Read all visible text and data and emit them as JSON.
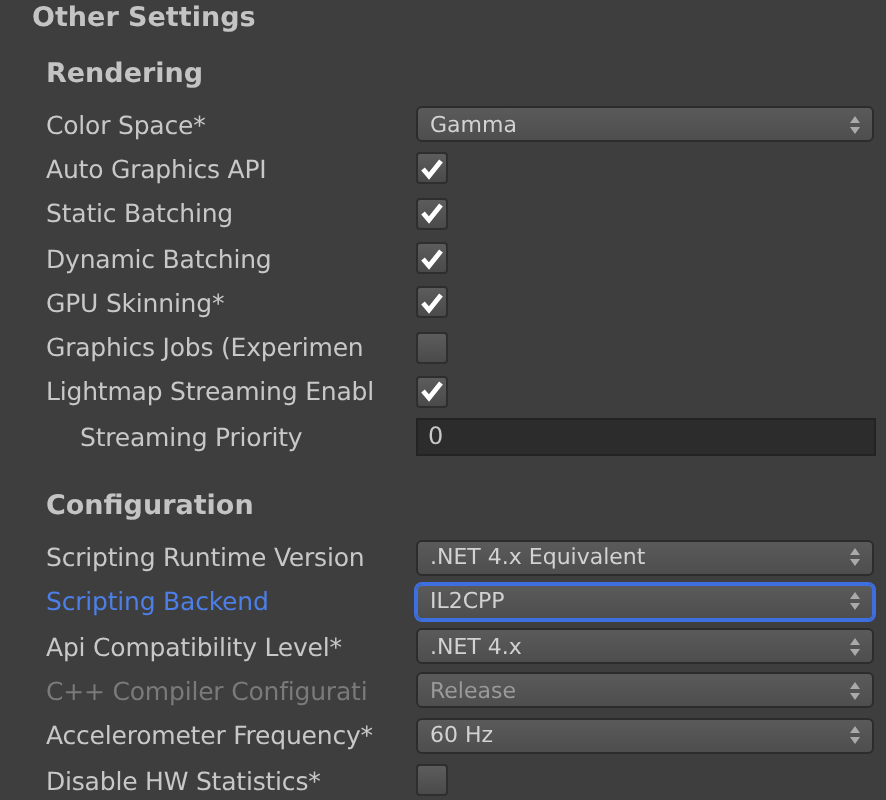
{
  "title": "Other Settings",
  "sections": [
    {
      "heading": "Rendering",
      "rows": [
        {
          "kind": "dropdown",
          "label": "Color Space*",
          "value": "Gamma",
          "focused": false,
          "disabled": false
        },
        {
          "kind": "checkbox",
          "label": "Auto Graphics API",
          "checked": true,
          "disabled": false
        },
        {
          "kind": "checkbox",
          "label": "Static Batching",
          "checked": true,
          "disabled": false
        },
        {
          "kind": "checkbox",
          "label": "Dynamic Batching",
          "checked": true,
          "disabled": false
        },
        {
          "kind": "checkbox",
          "label": "GPU Skinning*",
          "checked": true,
          "disabled": false
        },
        {
          "kind": "checkbox",
          "label": "Graphics Jobs (Experimen",
          "checked": false,
          "disabled": false
        },
        {
          "kind": "checkbox",
          "label": "Lightmap Streaming Enabl",
          "checked": true,
          "disabled": false,
          "children": [
            {
              "kind": "textfield",
              "label": "Streaming Priority",
              "value": "0",
              "disabled": false
            }
          ]
        }
      ]
    },
    {
      "heading": "Configuration",
      "rows": [
        {
          "kind": "dropdown",
          "label": "Scripting Runtime Version",
          "value": ".NET 4.x Equivalent",
          "focused": false,
          "disabled": false
        },
        {
          "kind": "dropdown",
          "label": "Scripting Backend",
          "value": "IL2CPP",
          "focused": true,
          "disabled": false
        },
        {
          "kind": "dropdown",
          "label": "Api Compatibility Level*",
          "value": ".NET 4.x",
          "focused": false,
          "disabled": false
        },
        {
          "kind": "dropdown",
          "label": "C++ Compiler Configurati",
          "value": "Release",
          "focused": false,
          "disabled": true
        },
        {
          "kind": "dropdown",
          "label": "Accelerometer Frequency*",
          "value": "60 Hz",
          "focused": false,
          "disabled": false
        },
        {
          "kind": "checkbox",
          "label": "Disable HW Statistics*",
          "checked": false,
          "disabled": false
        }
      ]
    }
  ]
}
